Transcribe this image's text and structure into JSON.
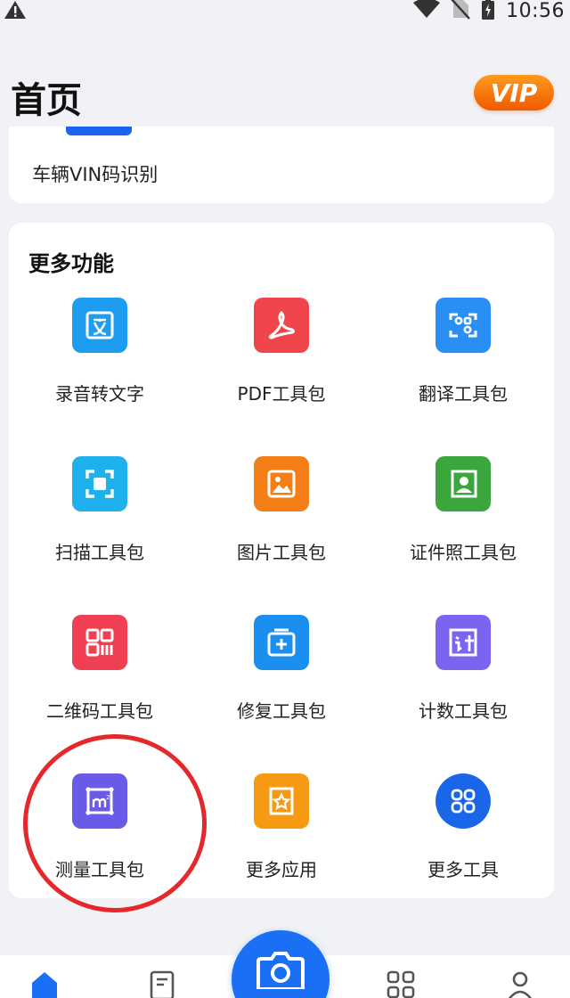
{
  "status_bar": {
    "time": "10:56"
  },
  "header": {
    "title": "首页",
    "vip_label": "VIP"
  },
  "top_card": {
    "item_label": "车辆VIN码识别"
  },
  "more_section": {
    "title": "更多功能",
    "tools": [
      {
        "label": "录音转文字",
        "icon": "text-doc-icon",
        "color": "#1e9cf0"
      },
      {
        "label": "PDF工具包",
        "icon": "pdf-icon",
        "color": "#f0454a"
      },
      {
        "label": "翻译工具包",
        "icon": "translate-icon",
        "color": "#2a8ff5"
      },
      {
        "label": "扫描工具包",
        "icon": "scan-icon",
        "color": "#1fb0ee"
      },
      {
        "label": "图片工具包",
        "icon": "image-icon",
        "color": "#f57f17"
      },
      {
        "label": "证件照工具包",
        "icon": "id-photo-icon",
        "color": "#3aa63c"
      },
      {
        "label": "二维码工具包",
        "icon": "qr-code-icon",
        "color": "#f03e52"
      },
      {
        "label": "修复工具包",
        "icon": "repair-icon",
        "color": "#1a8ff0"
      },
      {
        "label": "计数工具包",
        "icon": "counter-icon",
        "color": "#7a64f0"
      },
      {
        "label": "测量工具包",
        "icon": "measure-icon",
        "color": "#6a5ae8"
      },
      {
        "label": "更多应用",
        "icon": "star-frame-icon",
        "color": "#f59a12"
      },
      {
        "label": "更多工具",
        "icon": "grid-apps-icon",
        "color": "#1966e8"
      }
    ]
  },
  "bottom_nav": {
    "items": [
      "home",
      "docs",
      "camera",
      "apps",
      "profile"
    ],
    "accent": "#1a6ff5"
  }
}
